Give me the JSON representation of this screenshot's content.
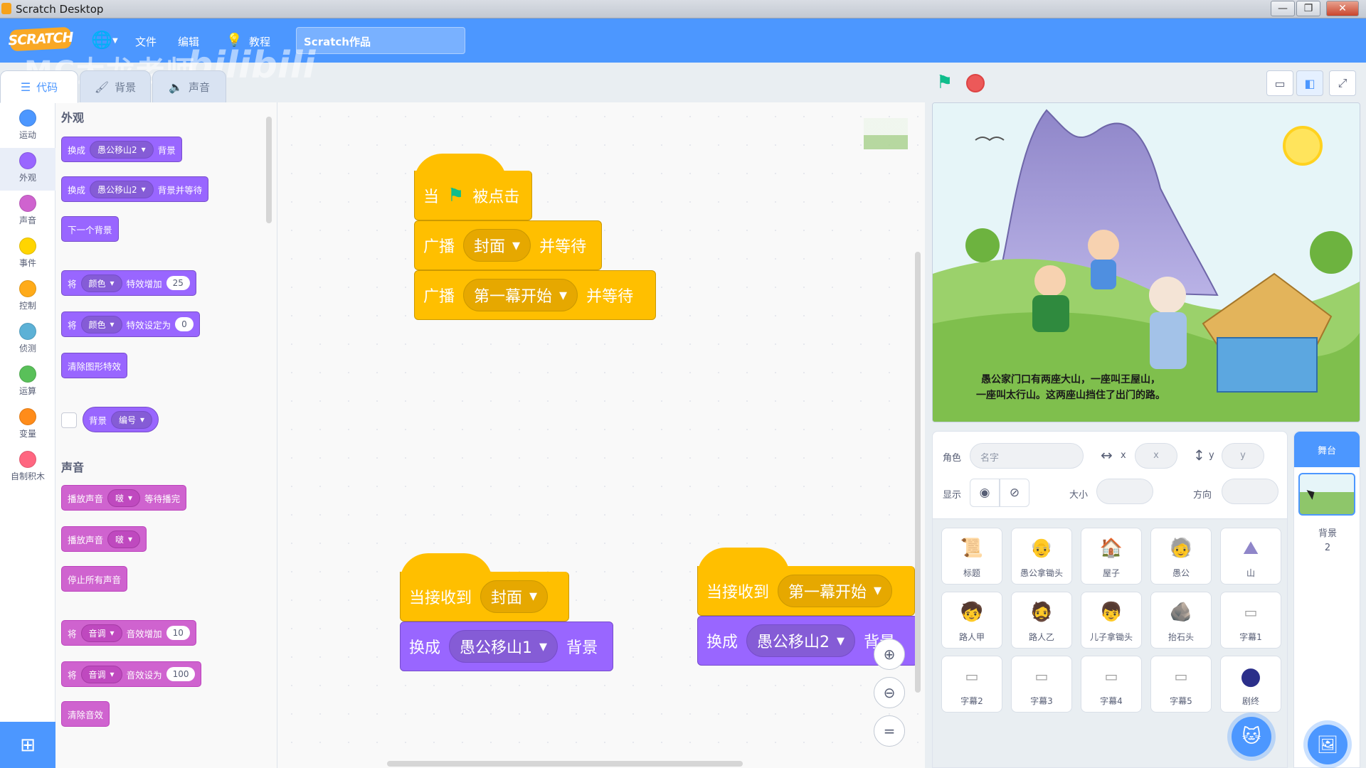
{
  "window": {
    "title": "Scratch Desktop",
    "minimize": "—",
    "restore": "❐",
    "close": "✕"
  },
  "menu": {
    "logo": "SCRATCH",
    "file": "文件",
    "edit": "编辑",
    "tutorials": "教程",
    "project_title": "Scratch作品",
    "watermark": "MC大龙老师",
    "watermark2": "bilibili"
  },
  "tabs": [
    {
      "label": "代码",
      "icon": "code-icon"
    },
    {
      "label": "背景",
      "icon": "brush-icon"
    },
    {
      "label": "声音",
      "icon": "speaker-icon"
    }
  ],
  "categories": [
    {
      "label": "运动",
      "color": "#4c97ff"
    },
    {
      "label": "外观",
      "color": "#9966ff"
    },
    {
      "label": "声音",
      "color": "#cf63cf"
    },
    {
      "label": "事件",
      "color": "#ffd500"
    },
    {
      "label": "控制",
      "color": "#ffab19"
    },
    {
      "label": "侦测",
      "color": "#5cb1d6"
    },
    {
      "label": "运算",
      "color": "#59c059"
    },
    {
      "label": "变量",
      "color": "#ff8c1a"
    },
    {
      "label": "自制积木",
      "color": "#ff6680"
    }
  ],
  "palette": {
    "looks_title": "外观",
    "sound_title": "声音",
    "switch_backdrop": {
      "pre": "换成",
      "value": "愚公移山2",
      "post": "背景"
    },
    "switch_backdrop_wait": {
      "pre": "换成",
      "value": "愚公移山2",
      "post": "背景并等待"
    },
    "next_backdrop": "下一个背景",
    "change_effect": {
      "pre": "将",
      "value": "颜色",
      "post": "特效增加",
      "num": "25"
    },
    "set_effect": {
      "pre": "将",
      "value": "颜色",
      "post": "特效设定为",
      "num": "0"
    },
    "clear_effects": "清除图形特效",
    "backdrop_reporter": {
      "pre": "背景",
      "value": "编号"
    },
    "play_until_done": {
      "pre": "播放声音",
      "value": "啵",
      "post": "等待播完"
    },
    "start_sound": {
      "pre": "播放声音",
      "value": "啵"
    },
    "stop_all_sounds": "停止所有声音",
    "change_sound_effect": {
      "pre": "将",
      "value": "音调",
      "post": "音效增加",
      "num": "10"
    },
    "set_sound_effect": {
      "pre": "将",
      "value": "音调",
      "post": "音效设为",
      "num": "100"
    },
    "clear_sound_effects": "清除音效"
  },
  "scripts": {
    "s1": {
      "hat_pre": "当",
      "hat_post": "被点击",
      "b1": {
        "pre": "广播",
        "value": "封面",
        "post": "并等待"
      },
      "b2": {
        "pre": "广播",
        "value": "第一幕开始",
        "post": "并等待"
      }
    },
    "s2": {
      "hat_pre": "当接收到",
      "hat_value": "封面",
      "b1": {
        "pre": "换成",
        "value": "愚公移山1",
        "post": "背景"
      }
    },
    "s3": {
      "hat_pre": "当接收到",
      "hat_value": "第一幕开始",
      "b1": {
        "pre": "换成",
        "value": "愚公移山2",
        "post": "背景"
      }
    }
  },
  "stage": {
    "caption_line1": "愚公家门口有两座大山，一座叫王屋山，",
    "caption_line2": "一座叫太行山。这两座山挡住了出门的路。"
  },
  "sprite_info": {
    "sprite_label": "角色",
    "name_placeholder": "名字",
    "x_label": "x",
    "x_placeholder": "x",
    "y_label": "y",
    "y_placeholder": "y",
    "show_label": "显示",
    "size_label": "大小",
    "direction_label": "方向"
  },
  "sprites": [
    {
      "name": "标题",
      "thumb": "📜"
    },
    {
      "name": "愚公拿锄头",
      "thumb": "👴"
    },
    {
      "name": "屋子",
      "thumb": "🏠"
    },
    {
      "name": "愚公",
      "thumb": "🧓"
    },
    {
      "name": "山",
      "thumb": "⛰"
    },
    {
      "name": "路人甲",
      "thumb": "🧒"
    },
    {
      "name": "路人乙",
      "thumb": "🧔"
    },
    {
      "name": "儿子拿锄头",
      "thumb": "👦"
    },
    {
      "name": "抬石头",
      "thumb": "🪨"
    },
    {
      "name": "字幕1",
      "thumb": "▭"
    },
    {
      "name": "字幕2",
      "thumb": "▭"
    },
    {
      "name": "字幕3",
      "thumb": "▭"
    },
    {
      "name": "字幕4",
      "thumb": "▭"
    },
    {
      "name": "字幕5",
      "thumb": "▭"
    },
    {
      "name": "剧终",
      "thumb": "●"
    }
  ],
  "stage_pane": {
    "header": "舞台",
    "backdrops_label": "背景",
    "backdrops_count": "2"
  },
  "colors": {
    "accent": "#4c97ff",
    "events": "#ffbf00",
    "looks": "#9966ff",
    "sound": "#cf63cf"
  }
}
